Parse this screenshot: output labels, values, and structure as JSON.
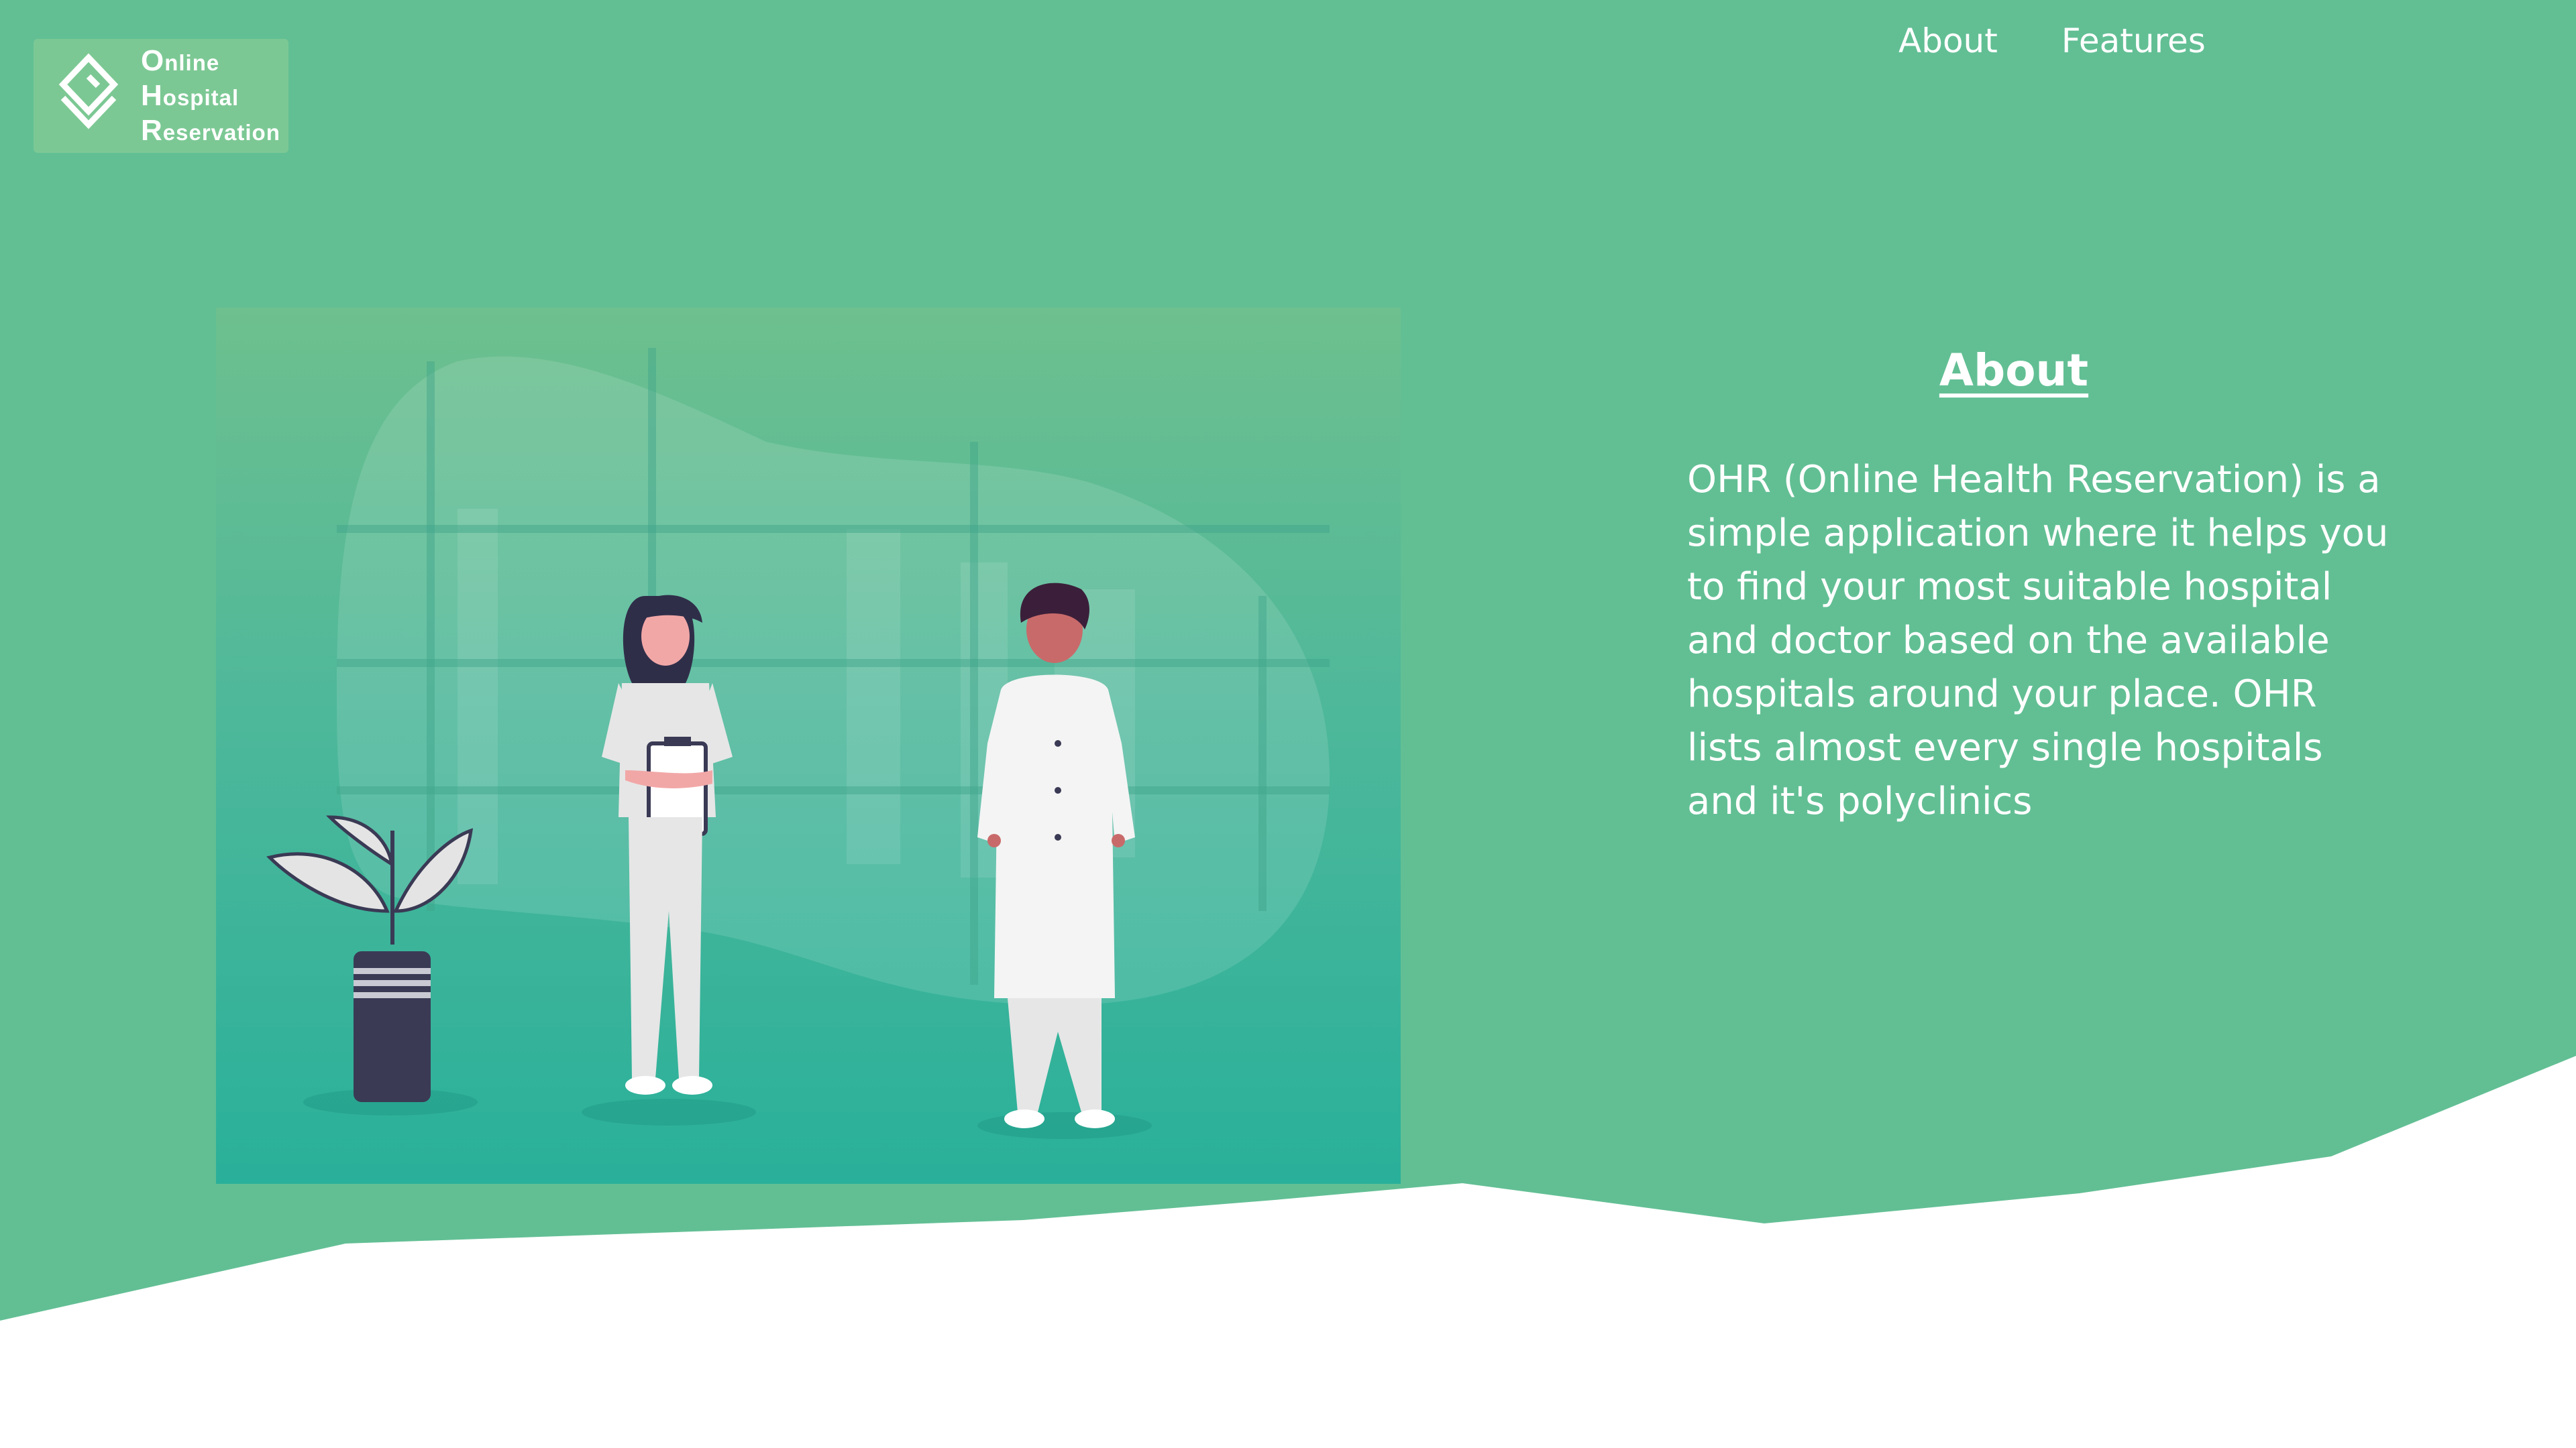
{
  "brand": {
    "logo_lines": [
      {
        "initial": "O",
        "rest": "nline"
      },
      {
        "initial": "H",
        "rest": "ospital"
      },
      {
        "initial": "R",
        "rest": "eservation"
      }
    ]
  },
  "nav": {
    "items": [
      {
        "label": "About"
      },
      {
        "label": "Features"
      }
    ]
  },
  "about": {
    "title": "About",
    "body": "OHR (Online Health Reservation) is a simple application where it helps you to find your most suitable hospital and doctor based on the available hospitals around your place. OHR lists almost every single hospitals and it's polyclinics"
  },
  "colors": {
    "primary_green": "#62bf94",
    "logo_bg": "#7cc894",
    "illustration_top": "#6ec08e",
    "illustration_bottom": "#29b09a",
    "text": "#ffffff"
  },
  "illustration": {
    "subject": "medical-staff-illustration",
    "icons": [
      "doctor-icon",
      "nurse-icon",
      "plant-icon",
      "city-window-icon"
    ]
  }
}
